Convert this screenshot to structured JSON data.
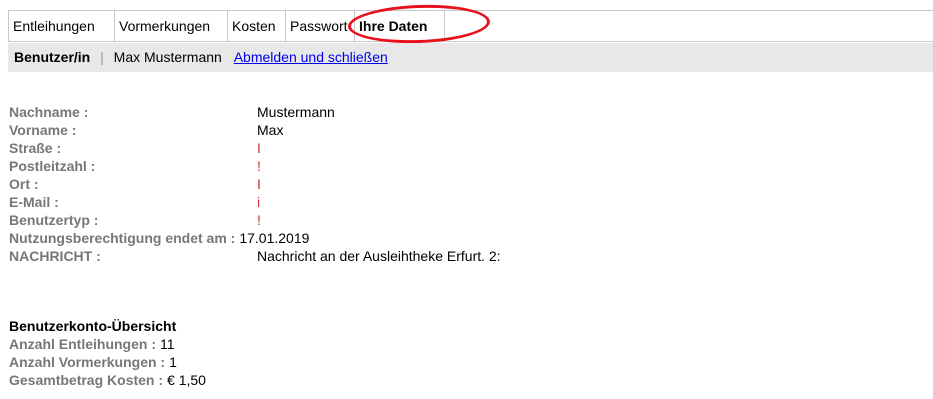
{
  "tabs": [
    {
      "label": "Entleihungen"
    },
    {
      "label": "Vormerkungen"
    },
    {
      "label": "Kosten"
    },
    {
      "label": "Passwort"
    },
    {
      "label": "Ihre Daten",
      "active": true
    }
  ],
  "userbar": {
    "label": "Benutzer/in",
    "separator": "|",
    "name": "Max Mustermann",
    "logout_link": "Abmelden und schließen"
  },
  "details": [
    {
      "key": "Nachname :",
      "value": "Mustermann"
    },
    {
      "key": "Vorname :",
      "value": "Max"
    },
    {
      "key": "Straße :",
      "value": "I"
    },
    {
      "key": "Postleitzahl :",
      "value": "!"
    },
    {
      "key": "Ort :",
      "value": "I"
    },
    {
      "key": "E-Mail :",
      "value": "i"
    },
    {
      "key": "Benutzertyp :",
      "value": "!"
    },
    {
      "key": "Nutzungsberechtigung endet am :",
      "value": "17.01.2019"
    },
    {
      "key": "NACHRICHT :",
      "value": "Nachricht an der Ausleihtheke Erfurt. 2:"
    }
  ],
  "summary": {
    "title": "Benutzerkonto-Übersicht",
    "rows": [
      {
        "key": "Anzahl Entleihungen :",
        "value": "11"
      },
      {
        "key": "Anzahl Vormerkungen :",
        "value": "1"
      },
      {
        "key": "Gesamtbetrag Kosten :",
        "value": "€ 1,50"
      }
    ]
  },
  "colors": {
    "highlight_circle": "#e8101b",
    "userbar_bg": "#e8e8e8",
    "link": "#0000ee",
    "label_gray": "#777777"
  }
}
